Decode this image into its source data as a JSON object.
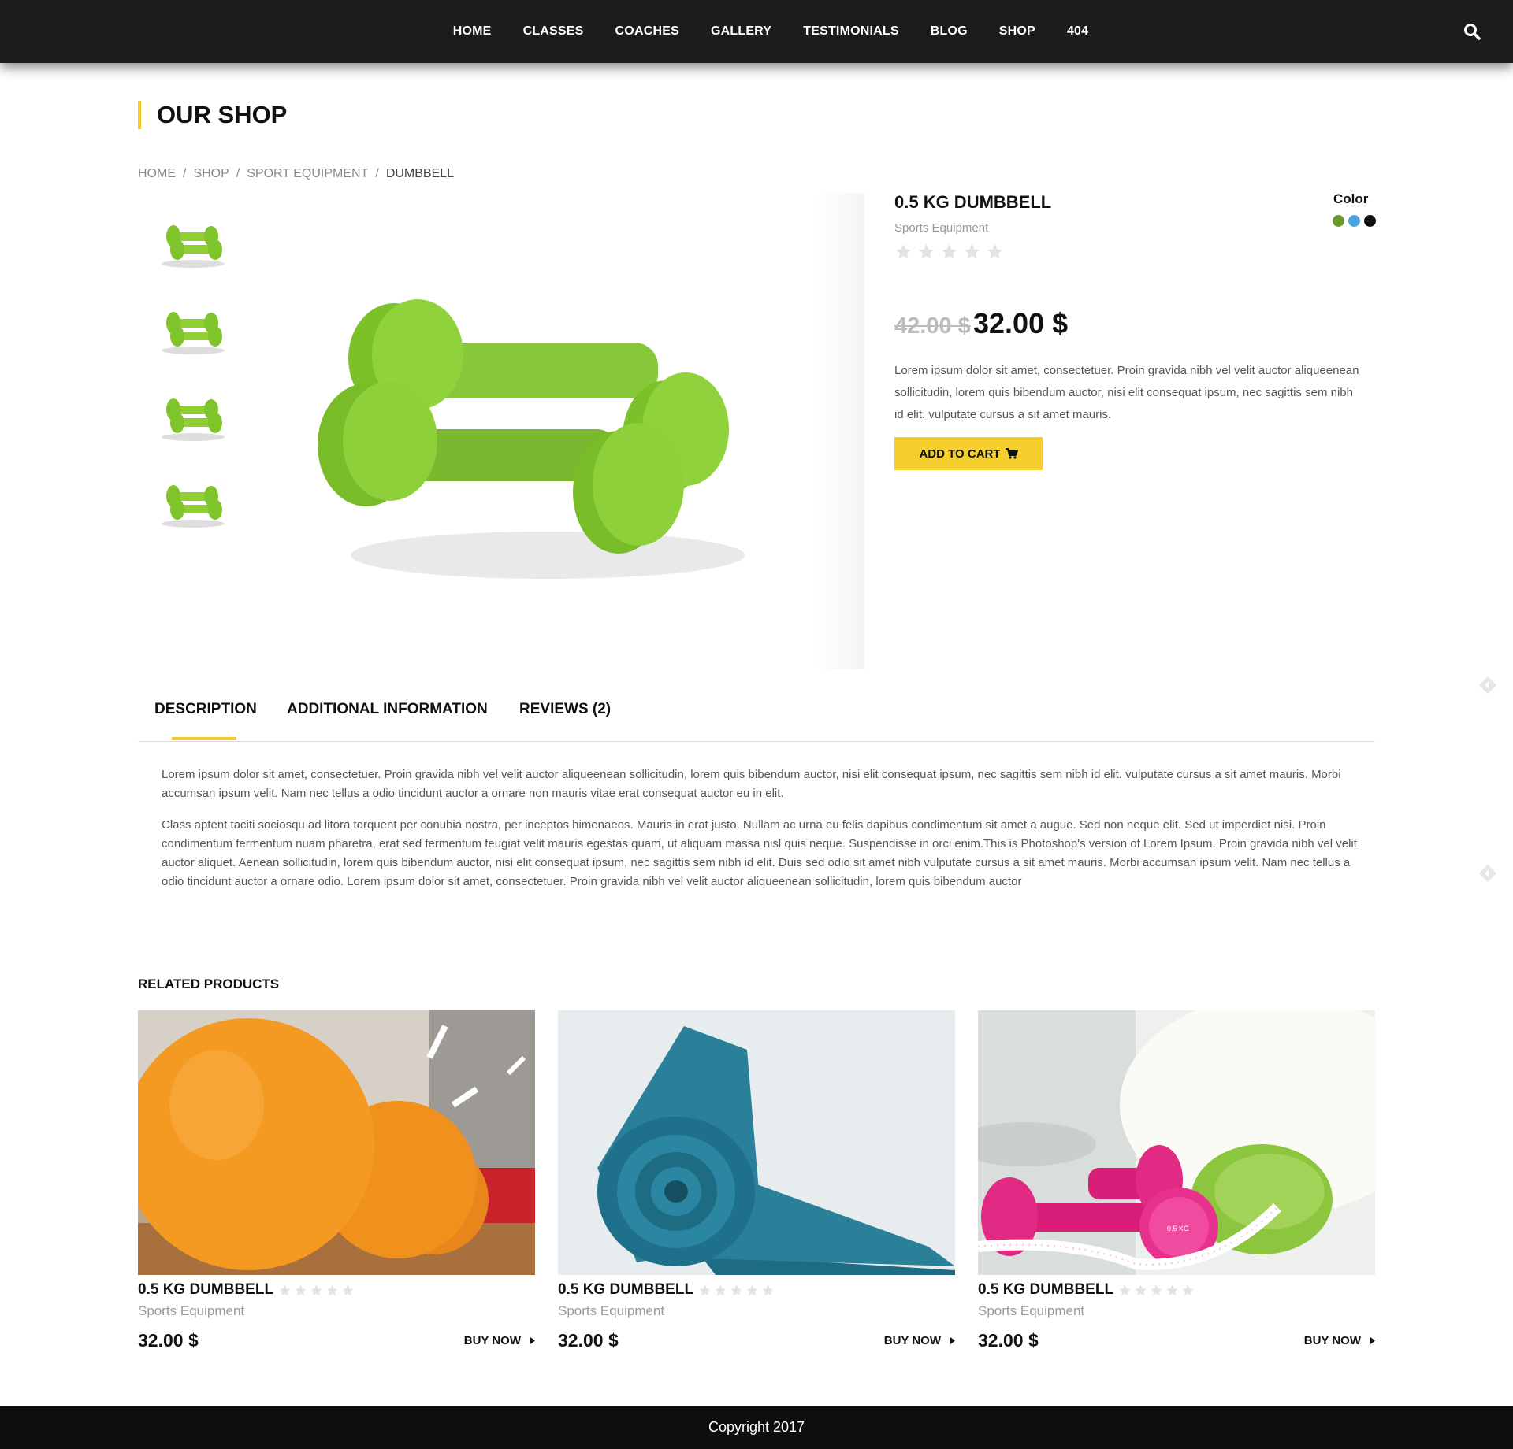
{
  "nav": {
    "items": [
      "HOME",
      "CLASSES",
      "COACHES",
      "GALLERY",
      "TESTIMONIALS",
      "BLOG",
      "SHOP",
      "404"
    ],
    "search_icon": "search-icon"
  },
  "page": {
    "title": "OUR SHOP"
  },
  "breadcrumb": [
    "HOME",
    "SHOP",
    "SPORT EQUIPMENT",
    "DUMBBELL"
  ],
  "product": {
    "title": "0.5 KG DUMBBELL",
    "category": "Sports Equipment",
    "rating": 0,
    "rating_max": 5,
    "color_label": "Color",
    "colors": [
      "#6c9a2e",
      "#4aa3e0",
      "#111111"
    ],
    "old_price": "42.00 $",
    "price": "32.00 $",
    "description": "Lorem ipsum dolor sit amet, consectetuer. Proin gravida nibh vel velit auctor aliqueenean sollicitudin, lorem quis bibendum auctor, nisi elit consequat ipsum, nec sagittis sem nibh id elit. vulputate cursus a sit amet mauris.",
    "add_to_cart": "ADD TO CART",
    "thumbnail_count": 4
  },
  "tabs": {
    "items": [
      "DESCRIPTION",
      "ADDITIONAL INFORMATION",
      "REVIEWS (2)"
    ],
    "active": "DESCRIPTION",
    "description_paragraphs": [
      "Lorem ipsum dolor sit amet, consectetuer. Proin gravida nibh vel velit auctor aliqueenean sollicitudin, lorem quis bibendum auctor, nisi elit consequat ipsum, nec sagittis sem nibh id elit. vulputate cursus a sit amet mauris. Morbi accumsan ipsum velit. Nam nec tellus a odio tincidunt auctor a ornare non mauris vitae erat consequat auctor eu in elit.",
      "Class aptent taciti sociosqu ad litora torquent per conubia nostra, per inceptos himenaeos. Mauris in erat justo. Nullam ac urna eu felis dapibus condimentum sit amet a augue. Sed non neque elit. Sed ut imperdiet nisi. Proin condimentum fermentum nuam pharetra, erat sed fermentum feugiat velit mauris egestas quam, ut aliquam massa nisl quis neque. Suspendisse in orci enim.This is Photoshop's version of Lorem Ipsum. Proin gravida nibh vel velit auctor aliquet. Aenean sollicitudin, lorem quis bibendum auctor, nisi elit consequat ipsum, nec sagittis sem nibh id elit. Duis sed odio sit amet nibh vulputate cursus a sit amet mauris. Morbi accumsan ipsum velit. Nam nec tellus a odio tincidunt auctor a ornare odio. Lorem ipsum dolor sit amet, consectetuer. Proin gravida nibh vel velit auctor aliqueenean sollicitudin, lorem quis bibendum auctor"
    ]
  },
  "related": {
    "title": "RELATED PRODUCTS",
    "products": [
      {
        "name": "0.5 KG DUMBBELL",
        "category": "Sports Equipment",
        "price": "32.00 $",
        "cta": "BUY NOW",
        "image": "orange-medicine-balls"
      },
      {
        "name": "0.5 KG DUMBBELL",
        "category": "Sports Equipment",
        "price": "32.00 $",
        "cta": "BUY NOW",
        "image": "blue-yoga-mat"
      },
      {
        "name": "0.5 KG DUMBBELL",
        "category": "Sports Equipment",
        "price": "32.00 $",
        "cta": "BUY NOW",
        "image": "pink-dumbbells",
        "image_label": "0.5 KG"
      }
    ]
  },
  "footer": {
    "copyright": "Copyright 2017"
  },
  "theme": {
    "accent": "#f5c82d",
    "nav_bg": "#1c1c1c",
    "footer_bg": "#0e0e0e"
  }
}
